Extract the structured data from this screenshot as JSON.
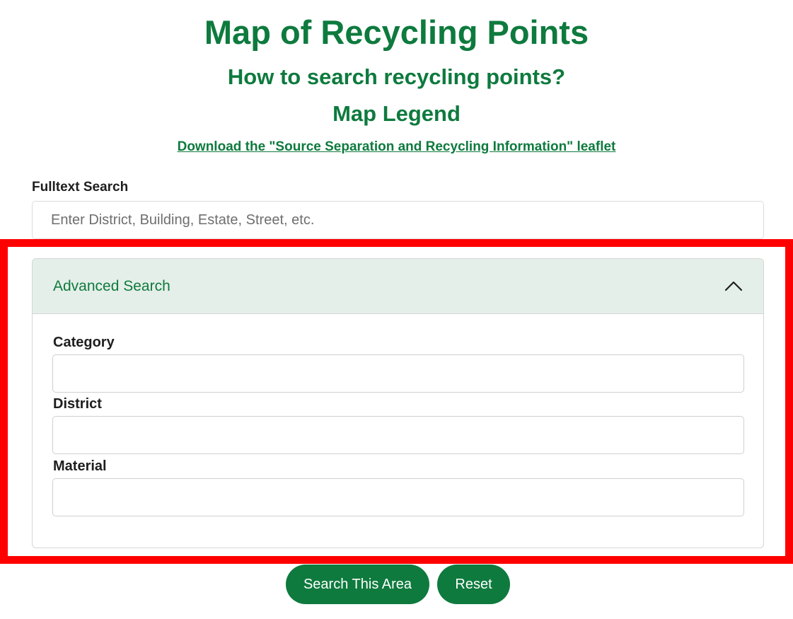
{
  "header": {
    "title": "Map of Recycling Points",
    "how_to_search": "How to search recycling points?",
    "map_legend": "Map Legend",
    "download_link": "Download the \"Source Separation and Recycling Information\" leaflet"
  },
  "fulltext": {
    "label": "Fulltext Search",
    "placeholder": "Enter District, Building, Estate, Street, etc.",
    "value": ""
  },
  "advanced": {
    "title": "Advanced Search",
    "expanded": true,
    "toggle_icon": "chevron-up-icon",
    "fields": [
      {
        "label": "Category",
        "value": ""
      },
      {
        "label": "District",
        "value": ""
      },
      {
        "label": "Material",
        "value": ""
      }
    ]
  },
  "buttons": {
    "search_label": "Search This Area",
    "reset_label": "Reset"
  },
  "colors": {
    "brand_green": "#0e7a3e",
    "accordion_header_bg": "#e5efe9",
    "highlight_frame": "#ff0000"
  }
}
